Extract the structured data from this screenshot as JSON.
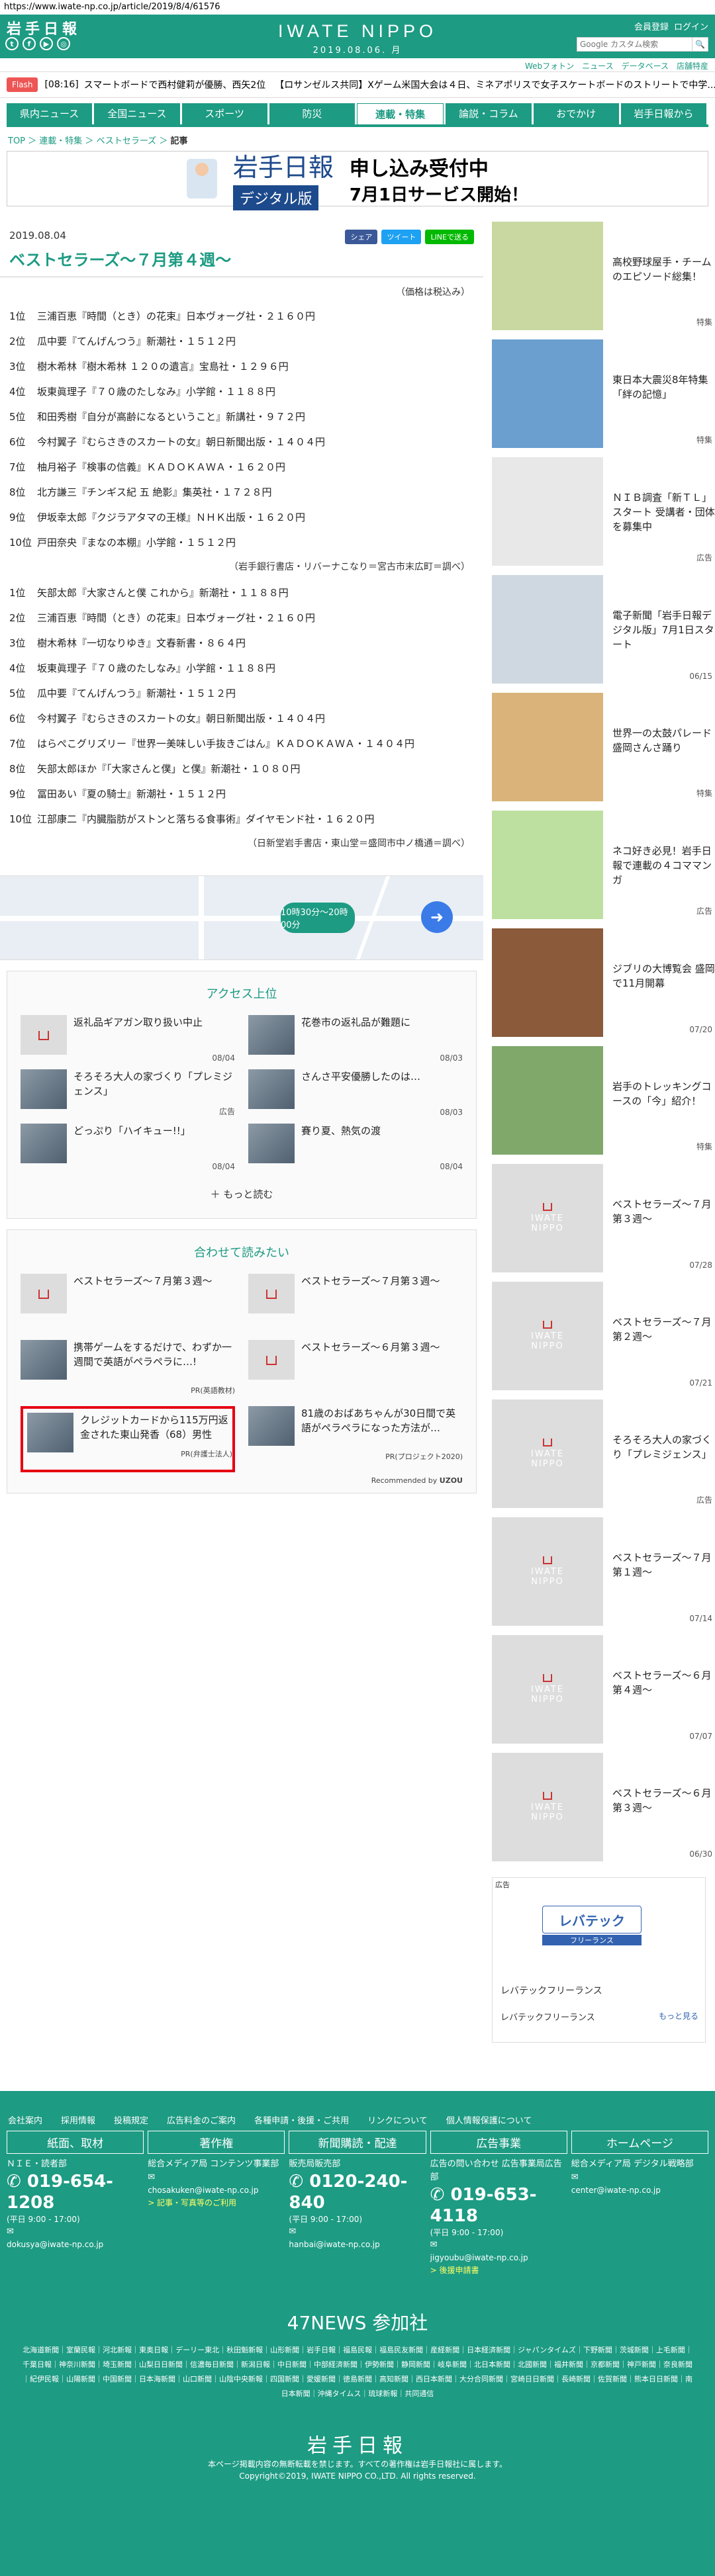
{
  "url": "https://www.iwate-np.co.jp/article/2019/8/4/61576",
  "header": {
    "logo": "岩手日報",
    "brand": "IWATE NIPPO",
    "date": "2019.08.06. 月",
    "account": [
      "会員登録",
      "ログイン"
    ],
    "search_placeholder": "Google カスタム検索",
    "sub_links": [
      "Webフォトン",
      "ニュース",
      "データベース",
      "店舗特産"
    ]
  },
  "flash": {
    "tag": "Flash",
    "time": "[08:16]",
    "items": [
      "スマートボードで西村健莉が優勝、西矢2位",
      "【ロサンゼルス共同】Xゲーム米国大会は４日、ミネアポリスで女子スケートボードのストリートで中学..."
    ]
  },
  "nav": [
    "県内ニュース",
    "全国ニュース",
    "スポーツ",
    "防災",
    "連載・特集",
    "論説・コラム",
    "おでかけ",
    "岩手日報から"
  ],
  "nav_active": 4,
  "breadcrumb": [
    "TOP",
    "連載・特集",
    "ベストセラーズ",
    "記事"
  ],
  "banner": {
    "logo": "岩手日報",
    "digital": "デジタル版",
    "headline": "申し込み受付中",
    "sub": "7月1日サービス開始！"
  },
  "article": {
    "date": "2019.08.04",
    "title": "ベストセラーズ〜７月第４週〜",
    "share": [
      "シェア",
      "ツイート",
      "LINEで送る"
    ],
    "note": "（価格は税込み）",
    "list1": [
      {
        "n": "1位",
        "t": "三浦百恵『時間（とき）の花束』日本ヴォーグ社・２１６０円"
      },
      {
        "n": "2位",
        "t": "瓜中要『てんげんつう』新潮社・１５１２円"
      },
      {
        "n": "3位",
        "t": "樹木希林『樹木希林 １２０の遺言』宝島社・１２９６円"
      },
      {
        "n": "4位",
        "t": "坂東眞理子『７０歳のたしなみ』小学館・１１８８円"
      },
      {
        "n": "5位",
        "t": "和田秀樹『自分が高齢になるということ』新講社・９７２円"
      },
      {
        "n": "6位",
        "t": "今村翼子『むらさきのスカートの女』朝日新聞出版・１４０４円"
      },
      {
        "n": "7位",
        "t": "柚月裕子『検事の信義』ＫＡＤＯＫＡＷＡ・１６２０円"
      },
      {
        "n": "8位",
        "t": "北方謙三『チンギス紀 五 絶影』集英社・１７２８円"
      },
      {
        "n": "9位",
        "t": "伊坂幸太郎『クジラアタマの王様』ＮＨＫ出版・１６２０円"
      },
      {
        "n": "10位",
        "t": "戸田奈央『まなの本棚』小学館・１５１２円"
      }
    ],
    "source1": "（岩手銀行書店・リバーナこなり＝宮古市末広町＝調べ）",
    "list2": [
      {
        "n": "1位",
        "t": "矢部太郎『大家さんと僕 これから』新潮社・１１８８円"
      },
      {
        "n": "2位",
        "t": "三浦百恵『時間（とき）の花束』日本ヴォーグ社・２１６０円"
      },
      {
        "n": "3位",
        "t": "樹木希林『一切なりゆき』文春新書・８６４円"
      },
      {
        "n": "4位",
        "t": "坂東眞理子『７０歳のたしなみ』小学館・１１８８円"
      },
      {
        "n": "5位",
        "t": "瓜中要『てんげんつう』新潮社・１５１２円"
      },
      {
        "n": "6位",
        "t": "今村翼子『むらさきのスカートの女』朝日新聞出版・１４０４円"
      },
      {
        "n": "7位",
        "t": "はらぺこグリズリー『世界一美味しい手抜きごはん』ＫＡＤＯＫＡＷＡ・１４０４円"
      },
      {
        "n": "8位",
        "t": "矢部太郎ほか『「大家さんと僕」と僕』新潮社・１０８０円"
      },
      {
        "n": "9位",
        "t": "冨田あい『夏の騎士』新潮社・１５１２円"
      },
      {
        "n": "10位",
        "t": "江部康二『内臓脂肪がストンと落ちる食事術』ダイヤモンド社・１６２０円"
      }
    ],
    "source2": "（日新堂岩手書店・東山堂＝盛岡市中ノ橋通＝調べ）"
  },
  "map": {
    "route": "10時30分〜20時00分"
  },
  "access": {
    "title": "アクセス上位",
    "items": [
      {
        "title": "返礼品ギアガン取り扱い中止",
        "date": "08/04",
        "photo": false
      },
      {
        "title": "花巻市の返礼品が難題に",
        "date": "08/03",
        "photo": true
      },
      {
        "title": "そろそろ大人の家づくり「プレミジェンス」",
        "date": "広告",
        "photo": true
      },
      {
        "title": "さんさ平安優勝したのは…",
        "date": "08/03",
        "photo": true
      },
      {
        "title": "どっぷり「ハイキュー!!」",
        "date": "08/04",
        "photo": true
      },
      {
        "title": "賽り夏、熱気の渡",
        "date": "08/04",
        "photo": true
      }
    ],
    "more": "もっと読む"
  },
  "recommend": {
    "title": "合わせて読みたい",
    "items": [
      {
        "title": "ベストセラーズ〜７月第３週〜",
        "pr": "",
        "hl": false
      },
      {
        "title": "ベストセラーズ〜７月第３週〜",
        "pr": "",
        "hl": false
      },
      {
        "title": "携帯ゲームをするだけで、わずか一週間で英語がペラペラに…!",
        "pr": "PR(英語教材)",
        "hl": false
      },
      {
        "title": "ベストセラーズ〜６月第３週〜",
        "pr": "",
        "hl": false
      },
      {
        "title": "クレジットカードから115万円返金された東山発香（68）男性",
        "pr": "PR(弁護士法人)",
        "hl": true
      },
      {
        "title": "81歳のおばあちゃんが30日間で英語がペラペラになった方法が…",
        "pr": "PR(プロジェクト2020)",
        "hl": false
      }
    ],
    "powered": "Recommended by"
  },
  "side": [
    {
      "title": "高校野球屋手・チームのエピソード総集！",
      "date": "特集"
    },
    {
      "title": "東日本大震災8年特集「絆の記憶」",
      "date": "特集"
    },
    {
      "title": "ＮＩＢ調査「新ＴＬ」スタート 受講者・団体を募集中",
      "date": "広告"
    },
    {
      "title": "電子新聞「岩手日報デジタル版」7月1日スタート",
      "date": "06/15"
    },
    {
      "title": "世界一の太鼓パレード 盛岡さんさ踊り",
      "date": "特集"
    },
    {
      "title": "ネコ好き必見！岩手日報で連載の４コママンガ",
      "date": "広告"
    },
    {
      "title": "ジブリの大博覧会 盛岡で11月開幕",
      "date": "07/20"
    },
    {
      "title": "岩手のトレッキングコースの「今」紹介！",
      "date": "特集"
    },
    {
      "title": "ベストセラーズ〜７月第３週〜",
      "date": "07/28"
    },
    {
      "title": "ベストセラーズ〜７月第２週〜",
      "date": "07/21"
    },
    {
      "title": "そろそろ大人の家づくり「プレミジェンス」",
      "date": "広告"
    },
    {
      "title": "ベストセラーズ〜７月第１週〜",
      "date": "07/14"
    },
    {
      "title": "ベストセラーズ〜６月第４週〜",
      "date": "07/07"
    },
    {
      "title": "ベストセラーズ〜６月第３週〜",
      "date": "06/30"
    }
  ],
  "ad": {
    "label": "広告",
    "brand": "レバテック",
    "sub": "フリーランス",
    "text1": "レバテックフリーランス",
    "text2": "レバテックフリーランス",
    "more": "もっと見る"
  },
  "footer": {
    "links": [
      "会社案内",
      "採用情報",
      "投稿規定",
      "広告料金のご案内",
      "各種申請・後援・ご共用",
      "リンクについて",
      "個人情報保護について"
    ],
    "cols": [
      {
        "hd": "紙面、取材",
        "l1": "ＮＩＥ・読者部",
        "phone": "019-654-1208",
        "hours": "(平日 9:00 - 17:00)",
        "mail": "dokusya@iwate-np.co.jp",
        "link": ""
      },
      {
        "hd": "著作権",
        "l1": "総合メディア局 コンテンツ事業部",
        "phone": "",
        "hours": "",
        "mail": "chosakuken@iwate-np.co.jp",
        "link": "> 記事・写真等のご利用"
      },
      {
        "hd": "新聞購読・配達",
        "l1": "販売局販売部",
        "phone": "0120-240-840",
        "hours": "(平日 9:00 - 17:00)",
        "mail": "hanbai@iwate-np.co.jp",
        "link": ""
      },
      {
        "hd": "広告事業",
        "l1": "広告の問い合わせ 広告事業局広告部",
        "phone": "019-653-4118",
        "hours": "(平日 9:00 - 17:00)",
        "mail": "jigyoubu@iwate-np.co.jp",
        "link": "> 後援申請書"
      },
      {
        "hd": "ホームページ",
        "l1": "総合メディア局 デジタル戦略部",
        "phone": "",
        "hours": "",
        "mail": "center@iwate-np.co.jp",
        "link": ""
      }
    ],
    "news47": "47NEWS 参加社",
    "papers": "北海道新聞｜室蘭民報｜河北新報｜東奥日報｜デーリー東北｜秋田魁新報｜山形新聞｜岩手日報｜福島民報｜福島民友新聞｜産経新聞｜日本経済新聞｜ジャパンタイムズ｜下野新聞｜茨城新聞｜上毛新聞｜千葉日報｜神奈川新聞｜埼玉新聞｜山梨日日新聞｜信濃毎日新聞｜新潟日報｜中日新聞｜中部経済新聞｜伊勢新聞｜静岡新聞｜岐阜新聞｜北日本新聞｜北國新聞｜福井新聞｜京都新聞｜神戸新聞｜奈良新聞｜紀伊民報｜山陽新聞｜中国新聞｜日本海新聞｜山口新聞｜山陰中央新報｜四国新聞｜愛媛新聞｜徳島新聞｜高知新聞｜西日本新聞｜大分合同新聞｜宮崎日日新聞｜長崎新聞｜佐賀新聞｜熊本日日新聞｜南日本新聞｜沖縄タイムス｜琉球新報｜共同通信",
    "logo": "岩手日報",
    "copy1": "本ページ掲載内容の無断転載を禁じます。すべての著作権は岩手日報社に属します。",
    "copy2": "Copyright©2019, IWATE NIPPO CO.,LTD. All rights reserved."
  }
}
